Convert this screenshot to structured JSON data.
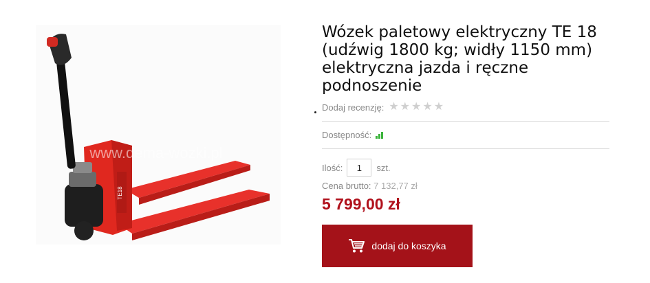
{
  "product": {
    "title": "Wózek paletowy elektryczny TE 18 (udźwig 1800 kg; widły 1150 mm) elektryczna jazda i ręczne podnoszenie",
    "watermark": "www.dema-wozki.pl",
    "brand_text": "TE18"
  },
  "review": {
    "label": "Dodaj recenzję:",
    "stars": 5,
    "rating": 0
  },
  "availability": {
    "label": "Dostępność:",
    "level": 3,
    "color": "#3cb43c"
  },
  "quantity": {
    "label": "Ilość:",
    "value": "1",
    "unit": "szt."
  },
  "gross_price": {
    "label": "Cena brutto:",
    "value": "7 132,77 zł"
  },
  "price": {
    "value": "5 799,00 zł",
    "color": "#b0111c"
  },
  "cart": {
    "button_label": "dodaj do koszyka",
    "icon": "cart-icon",
    "color": "#a41219"
  }
}
